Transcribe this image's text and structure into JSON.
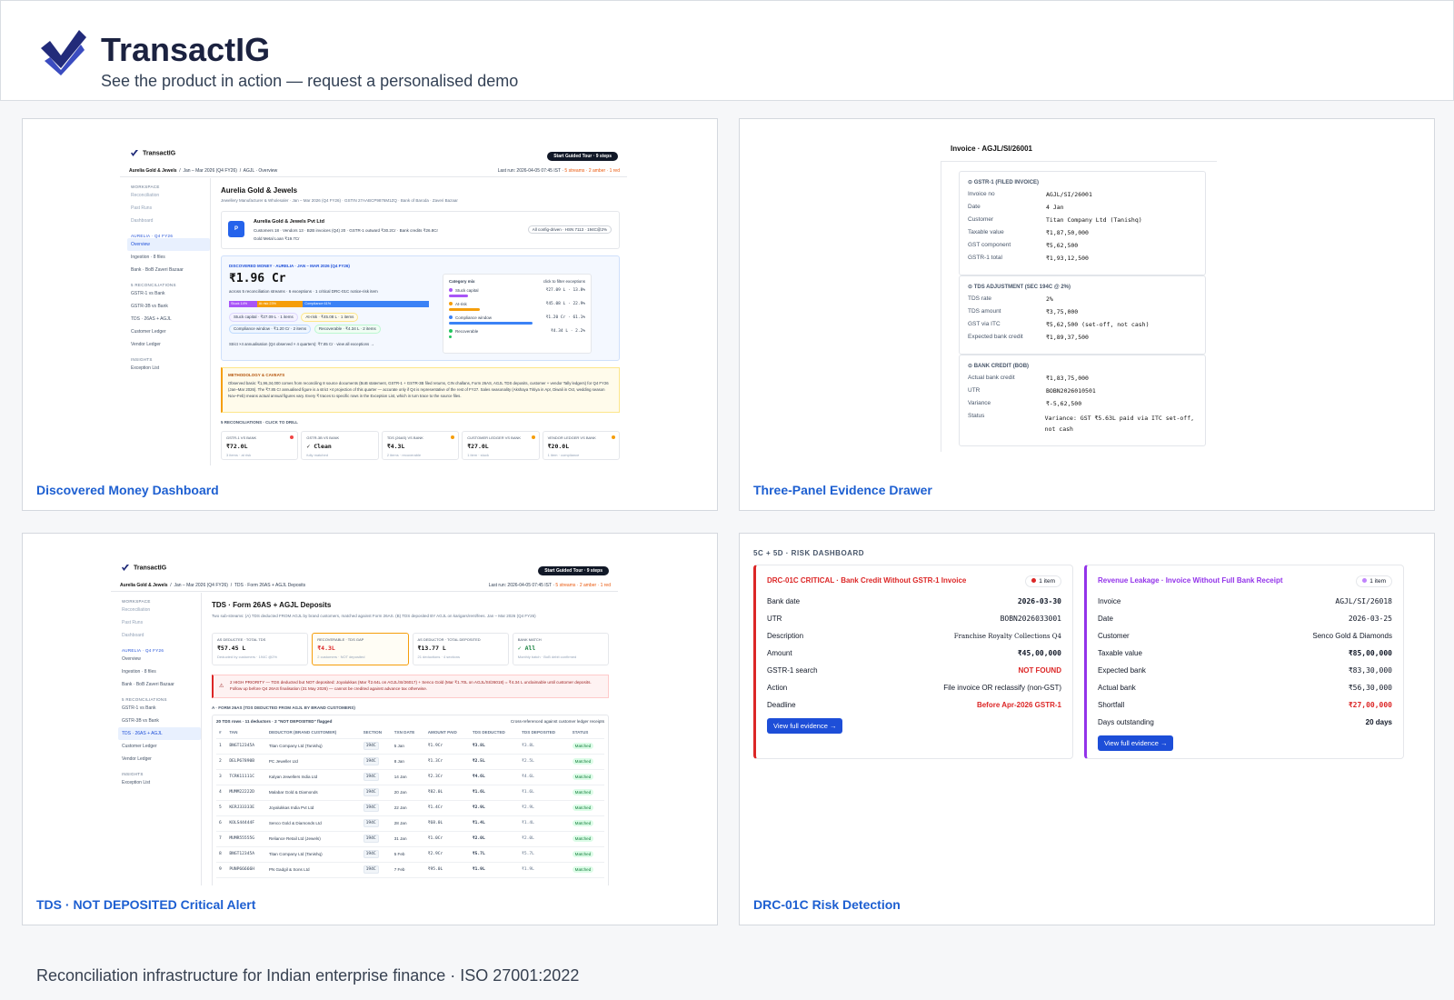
{
  "brand": {
    "name": "TransactIG",
    "tagline": "See the product in action — request a personalised demo"
  },
  "footer": "Reconciliation infrastructure for Indian enterprise finance · ISO 27001:2022",
  "cards": [
    {
      "title": "Discovered Money Dashboard"
    },
    {
      "title": "Three-Panel Evidence Drawer"
    },
    {
      "title": "TDS · NOT DEPOSITED Critical Alert"
    },
    {
      "title": "DRC-01C Risk Detection"
    }
  ],
  "app": {
    "logo": "TransactIG",
    "tour": "Start Guided Tour · 9 steps",
    "crumb_entity": "Aurelia Gold & Jewels",
    "crumb_period": "Jan – Mar 2026 (Q4 FY26)",
    "last_run": "Last run: 2026-04-05 07:45 IST",
    "streams": "5 streams · 2 amber · 1 red",
    "sidebar": {
      "workspace": "WORKSPACE",
      "ws_items": [
        "Reconciliation",
        "Past Runs",
        "Dashboard"
      ],
      "group": "AURELIA · Q4 FY26",
      "group_items": [
        "Overview",
        "Ingestion · 8 files",
        "Bank · BoB Zaveri Bazaar"
      ],
      "recon": "5 RECONCILIATIONS",
      "recon_items": [
        "GSTR-1 vs Bank",
        "GSTR-3B vs Bank",
        "TDS · 26AS + AGJL",
        "Customer Ledger",
        "Vendor Ledger"
      ],
      "insights": "INSIGHTS",
      "insight_items": [
        "Exception List"
      ]
    }
  },
  "dashboard": {
    "crumb_page": "AGJL · Overview",
    "title": "Aurelia Gold & Jewels",
    "subtitle": "Jewellery Manufacturer & Wholesaler · Jan – Mar 2026 (Q4 FY26) · GSTIN 27AABCP9876M1ZQ · Bank of Baroda · Zaveri Bazaar",
    "company": "Aurelia Gold & Jewels Pvt Ltd",
    "company_stats": "Customers 18 · Vendors 13 · B2B invoices (Q4) 20 · GSTR-1 outward ₹30.2Cr · Bank credits ₹26.8Cr",
    "gold_loan": "Gold Metal Loan ₹19.7Cr",
    "config_badge": "All config-driven · HSN 7113 · 194C@2%",
    "dm_label": "DISCOVERED MONEY · AURELIA · JAN – MAR 2026 (Q4 FY26)",
    "dm_value": "₹1.96 Cr",
    "dm_desc": "across 5 reconciliation streams · 6 exceptions · 1 critical DRC-01C notice-risk item",
    "bar": [
      "Stuck 14%",
      "At risk 23%",
      "Compliance 61%"
    ],
    "pills": [
      "Stuck capital · ₹27.09 L · 1 items",
      "At-risk · ₹45.08 L · 1 items",
      "Compliance window · ₹1.20 Cr · 2 items",
      "Recoverable · ₹4.34 L · 2 items"
    ],
    "annual": "Strict ×4 annualisation (Q4 observed × 4 quarters): ₹7.85 Cr · view all exceptions →",
    "mix_title": "Category mix",
    "mix_hint": "click to filter exceptions",
    "mix": [
      {
        "label": "Stuck capital",
        "value": "₹27.09 L · 13.8%",
        "pct": 13.8,
        "color": "#a855f7"
      },
      {
        "label": "At-risk",
        "value": "₹45.08 L · 22.9%",
        "pct": 22.9,
        "color": "#f59e0b"
      },
      {
        "label": "Compliance window",
        "value": "₹1.20 Cr · 61.1%",
        "pct": 61.1,
        "color": "#3b82f6"
      },
      {
        "label": "Recoverable",
        "value": "₹4.34 L · 2.2%",
        "pct": 2.2,
        "color": "#22c55e"
      }
    ],
    "method_title": "METHODOLOGY & CAVEATS",
    "method_text": "Observed basis: ₹1,96,34,000 comes from reconciling 8 source documents (BoB statement, GSTR-1 + GSTR-3B filed returns, CIN challans, Form 26AS, AGJL TDS deposits, customer + vendor Tally ledgers) for Q4 FY26 (Jan–Mar 2026). The ₹7.85 Cr annualised figure is a strict ×4 projection of this quarter — accurate only if Q4 is representative of the rest of FY27. Sales seasonality (Akshaya Tritiya in Apr, Diwali in Oct, wedding season Nov–Feb) means actual annual figures vary. Every ₹ traces to specific rows in the Exception List, which in turn trace to the source files.",
    "recon_title": "5 RECONCILIATIONS · CLICK TO DRILL",
    "recons": [
      {
        "name": "GSTR-1 VS BANK",
        "value": "₹72.0L",
        "note": "3 items · at risk",
        "dot": "#ef4444"
      },
      {
        "name": "GSTR-3B VS BANK",
        "value": "✓ Clean",
        "note": "fully matched",
        "dot": "#ffffff"
      },
      {
        "name": "TDS (26AS) VS BANK",
        "value": "₹4.3L",
        "note": "2 items · recoverable",
        "dot": "#f59e0b"
      },
      {
        "name": "CUSTOMER LEDGER VS BANK",
        "value": "₹27.0L",
        "note": "1 item · stuck",
        "dot": "#f59e0b"
      },
      {
        "name": "VENDOR LEDGER VS BANK",
        "value": "₹20.0L",
        "note": "1 item · compliance",
        "dot": "#f59e0b"
      }
    ]
  },
  "drawer": {
    "title": "Invoice · AGJL/SI/26001",
    "sections": [
      {
        "title": "⊙ GSTR-1 (FILED INVOICE)",
        "rows": [
          [
            "Invoice no",
            "AGJL/SI/26001"
          ],
          [
            "Date",
            "4 Jan"
          ],
          [
            "Customer",
            "Titan Company Ltd (Tanishq)"
          ],
          [
            "Taxable value",
            "₹1,87,50,000"
          ],
          [
            "GST component",
            "₹5,62,500"
          ],
          [
            "GSTR-1 total",
            "₹1,93,12,500"
          ]
        ]
      },
      {
        "title": "⊙ TDS ADJUSTMENT (SEC 194C @ 2%)",
        "rows": [
          [
            "TDS rate",
            "2%"
          ],
          [
            "TDS amount",
            "₹3,75,000"
          ],
          [
            "GST via ITC",
            "₹5,62,500 (set-off, not cash)"
          ],
          [
            "Expected bank credit",
            "₹1,89,37,500"
          ]
        ]
      },
      {
        "title": "⊙ BANK CREDIT (BOB)",
        "rows": [
          [
            "Actual bank credit",
            "₹1,83,75,000"
          ],
          [
            "UTR",
            "BOBN2026010501"
          ],
          [
            "Variance",
            "₹-5,62,500"
          ],
          [
            "Status",
            "Variance: GST ₹5.63L paid via ITC set-off, not cash"
          ]
        ]
      }
    ]
  },
  "tds": {
    "crumb_page": "TDS · Form 26AS + AGJL Deposits",
    "title": "TDS · Form 26AS + AGJL Deposits",
    "subtitle": "Two sub-streams: (A) TDS deducted FROM AGJL by brand customers, matched against Form 26AS. (B) TDS deposited BY AGJL on karigars/rent/fees. Jan – Mar 2026 (Q4 FY26)",
    "kpis": [
      {
        "label": "AS DEDUCTEE · TOTAL TDS",
        "value": "₹57.45 L",
        "note": "Deducted by customers · 194C @2%"
      },
      {
        "label": "RECOVERABLE · TDS GAP",
        "value": "₹4.3L",
        "note": "2 customers · NOT deposited"
      },
      {
        "label": "AS DEDUCTOR · TOTAL DEPOSITED",
        "value": "₹13.77 L",
        "note": "21 deductions · 4 sections"
      },
      {
        "label": "BANK MATCH",
        "value": "✓ All",
        "note": "Monthly batch · BoB debit confirmed"
      }
    ],
    "alert": "2 HIGH PRIORITY — TDS deducted but NOT deposited: Joyalukkas (Mar ₹2.64L on AGJL/SI/26017) + Senco Gold (Mar ₹1.70L on AGJL/SI/26018) = ₹4.34 L unclaimable until customer deposits. Follow up before Q4 26AS finalisation (31 May 2026) — cannot be credited against advance tax otherwise.",
    "section": "A · FORM 26AS (TDS DEDUCTED FROM AGJL BY BRAND CUSTOMERS)",
    "table_title": "20 TDS rows · 11 deductors · 2 \"NOT DEPOSITED\" flagged",
    "table_hint": "Cross-referenced against customer ledger receipts",
    "headers": [
      "#",
      "TAN",
      "DEDUCTOR (BRAND CUSTOMER)",
      "SECTION",
      "TXN DATE",
      "AMOUNT PAID",
      "TDS DEDUCTED",
      "TDS DEPOSITED",
      "STATUS"
    ],
    "rows": [
      [
        "1",
        "BNGT12345A",
        "Titan Company Ltd (Tanishq)",
        "194C",
        "5 Jan",
        "₹1.9Cr",
        "₹3.8L",
        "₹3.8L",
        "Matched"
      ],
      [
        "2",
        "DELP67890B",
        "PC Jeweller Ltd",
        "194C",
        "8 Jan",
        "₹1.3Cr",
        "₹2.5L",
        "₹2.5L",
        "Matched"
      ],
      [
        "3",
        "TCRK11111C",
        "Kalyan Jewellers India Ltd",
        "194C",
        "14 Jan",
        "₹2.3Cr",
        "₹4.6L",
        "₹4.6L",
        "Matched"
      ],
      [
        "4",
        "MUMM22222D",
        "Malabar Gold & Diamonds",
        "194C",
        "20 Jan",
        "₹82.0L",
        "₹1.6L",
        "₹1.6L",
        "Matched"
      ],
      [
        "5",
        "KERJ33333E",
        "Joyalukkas India Pvt Ltd",
        "194C",
        "22 Jan",
        "₹1.4Cr",
        "₹2.9L",
        "₹2.9L",
        "Matched"
      ],
      [
        "6",
        "KOLS44444F",
        "Senco Gold & Diamonds Ltd",
        "194C",
        "28 Jan",
        "₹68.0L",
        "₹1.4L",
        "₹1.4L",
        "Matched"
      ],
      [
        "7",
        "MUMR55555G",
        "Reliance Retail Ltd (Jewels)",
        "194C",
        "31 Jan",
        "₹1.0Cr",
        "₹2.0L",
        "₹2.0L",
        "Matched"
      ],
      [
        "8",
        "BNGT12345A",
        "Titan Company Ltd (Tanishq)",
        "194C",
        "5 Feb",
        "₹2.9Cr",
        "₹5.7L",
        "₹5.7L",
        "Matched"
      ],
      [
        "9",
        "PUNP66666H",
        "PN Gadgil & Sons Ltd",
        "194C",
        "7 Feb",
        "₹95.0L",
        "₹1.9L",
        "₹1.9L",
        "Matched"
      ]
    ]
  },
  "risk": {
    "heading": "5C + 5D · RISK DASHBOARD",
    "cards": [
      {
        "title": "DRC-01C CRITICAL · Bank Credit Without GSTR-1 Invoice",
        "badge": "1 item",
        "color": "#dc2626",
        "rows": [
          [
            "Bank date",
            "2026-03-30"
          ],
          [
            "UTR",
            "BOBN2026033001"
          ],
          [
            "Description",
            "Franchise Royalty Collections Q4"
          ],
          [
            "Amount",
            "₹45,00,000"
          ],
          [
            "GSTR-1 search",
            "NOT FOUND"
          ],
          [
            "Action",
            "File invoice OR reclassify (non-GST)"
          ],
          [
            "Deadline",
            "Before Apr-2026 GSTR-1"
          ]
        ],
        "button": "View full evidence →"
      },
      {
        "title": "Revenue Leakage · Invoice Without Full Bank Receipt",
        "badge": "1 item",
        "color": "#9333ea",
        "rows": [
          [
            "Invoice",
            "AGJL/SI/26018"
          ],
          [
            "Date",
            "2026-03-25"
          ],
          [
            "Customer",
            "Senco Gold & Diamonds"
          ],
          [
            "Taxable value",
            "₹85,00,000"
          ],
          [
            "Expected bank",
            "₹83,30,000"
          ],
          [
            "Actual bank",
            "₹56,30,000"
          ],
          [
            "Shortfall",
            "₹27,00,000"
          ],
          [
            "Days outstanding",
            "20 days"
          ]
        ],
        "button": "View full evidence →"
      }
    ]
  }
}
